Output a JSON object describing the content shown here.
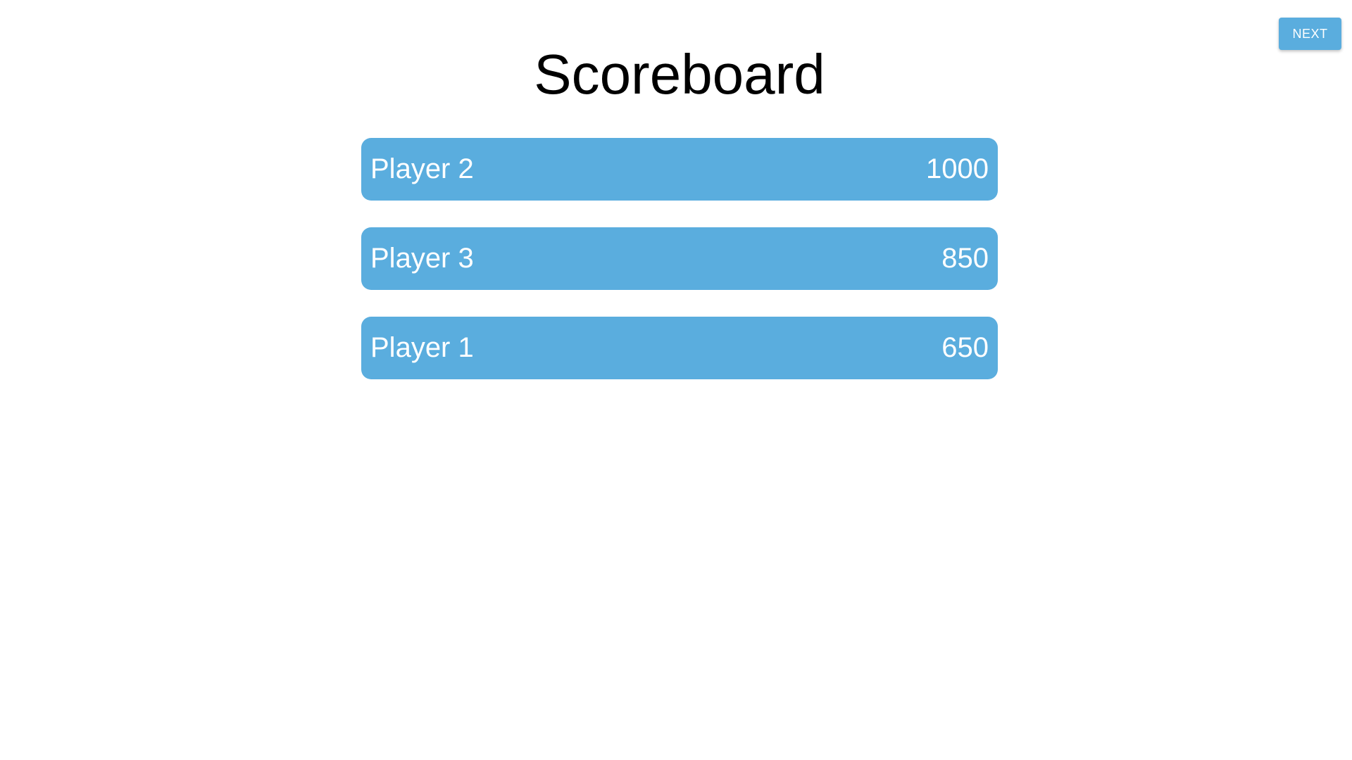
{
  "header": {
    "next_label": "NEXT",
    "title": "Scoreboard"
  },
  "scoreboard": {
    "rows": [
      {
        "name": "Player 2",
        "score": "1000"
      },
      {
        "name": "Player 3",
        "score": "850"
      },
      {
        "name": "Player 1",
        "score": "650"
      }
    ]
  },
  "colors": {
    "accent": "#5aadde",
    "text_on_accent": "#ffffff",
    "title": "#000000",
    "background": "#ffffff"
  }
}
